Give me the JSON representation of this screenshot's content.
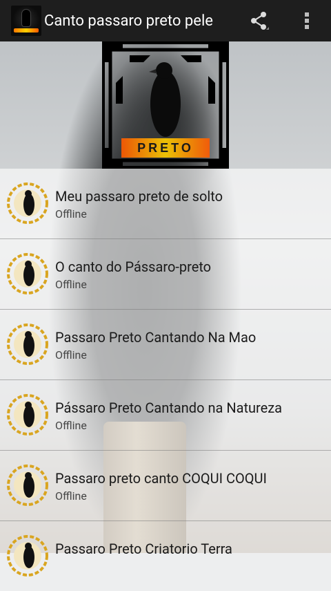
{
  "app": {
    "title": "Canto passaro preto pele"
  },
  "header": {
    "logo_text": "PRETO"
  },
  "list": {
    "items": [
      {
        "title": "Meu passaro preto de solto",
        "status": "Offline"
      },
      {
        "title": "O canto do Pássaro-preto",
        "status": "Offline"
      },
      {
        "title": "Passaro Preto Cantando Na Mao",
        "status": "Offline"
      },
      {
        "title": "Pássaro Preto Cantando na Natureza",
        "status": "Offline"
      },
      {
        "title": "Passaro preto canto COQUI COQUI",
        "status": "Offline"
      },
      {
        "title": "Passaro Preto Criatorio Terra",
        "status": ""
      }
    ]
  },
  "colors": {
    "actionbar": "#1e1e1e",
    "accent_orange": "#ff7a00",
    "accent_gold": "#d9a520"
  },
  "icons": {
    "share": "share-icon",
    "overflow": "overflow-menu-icon"
  }
}
